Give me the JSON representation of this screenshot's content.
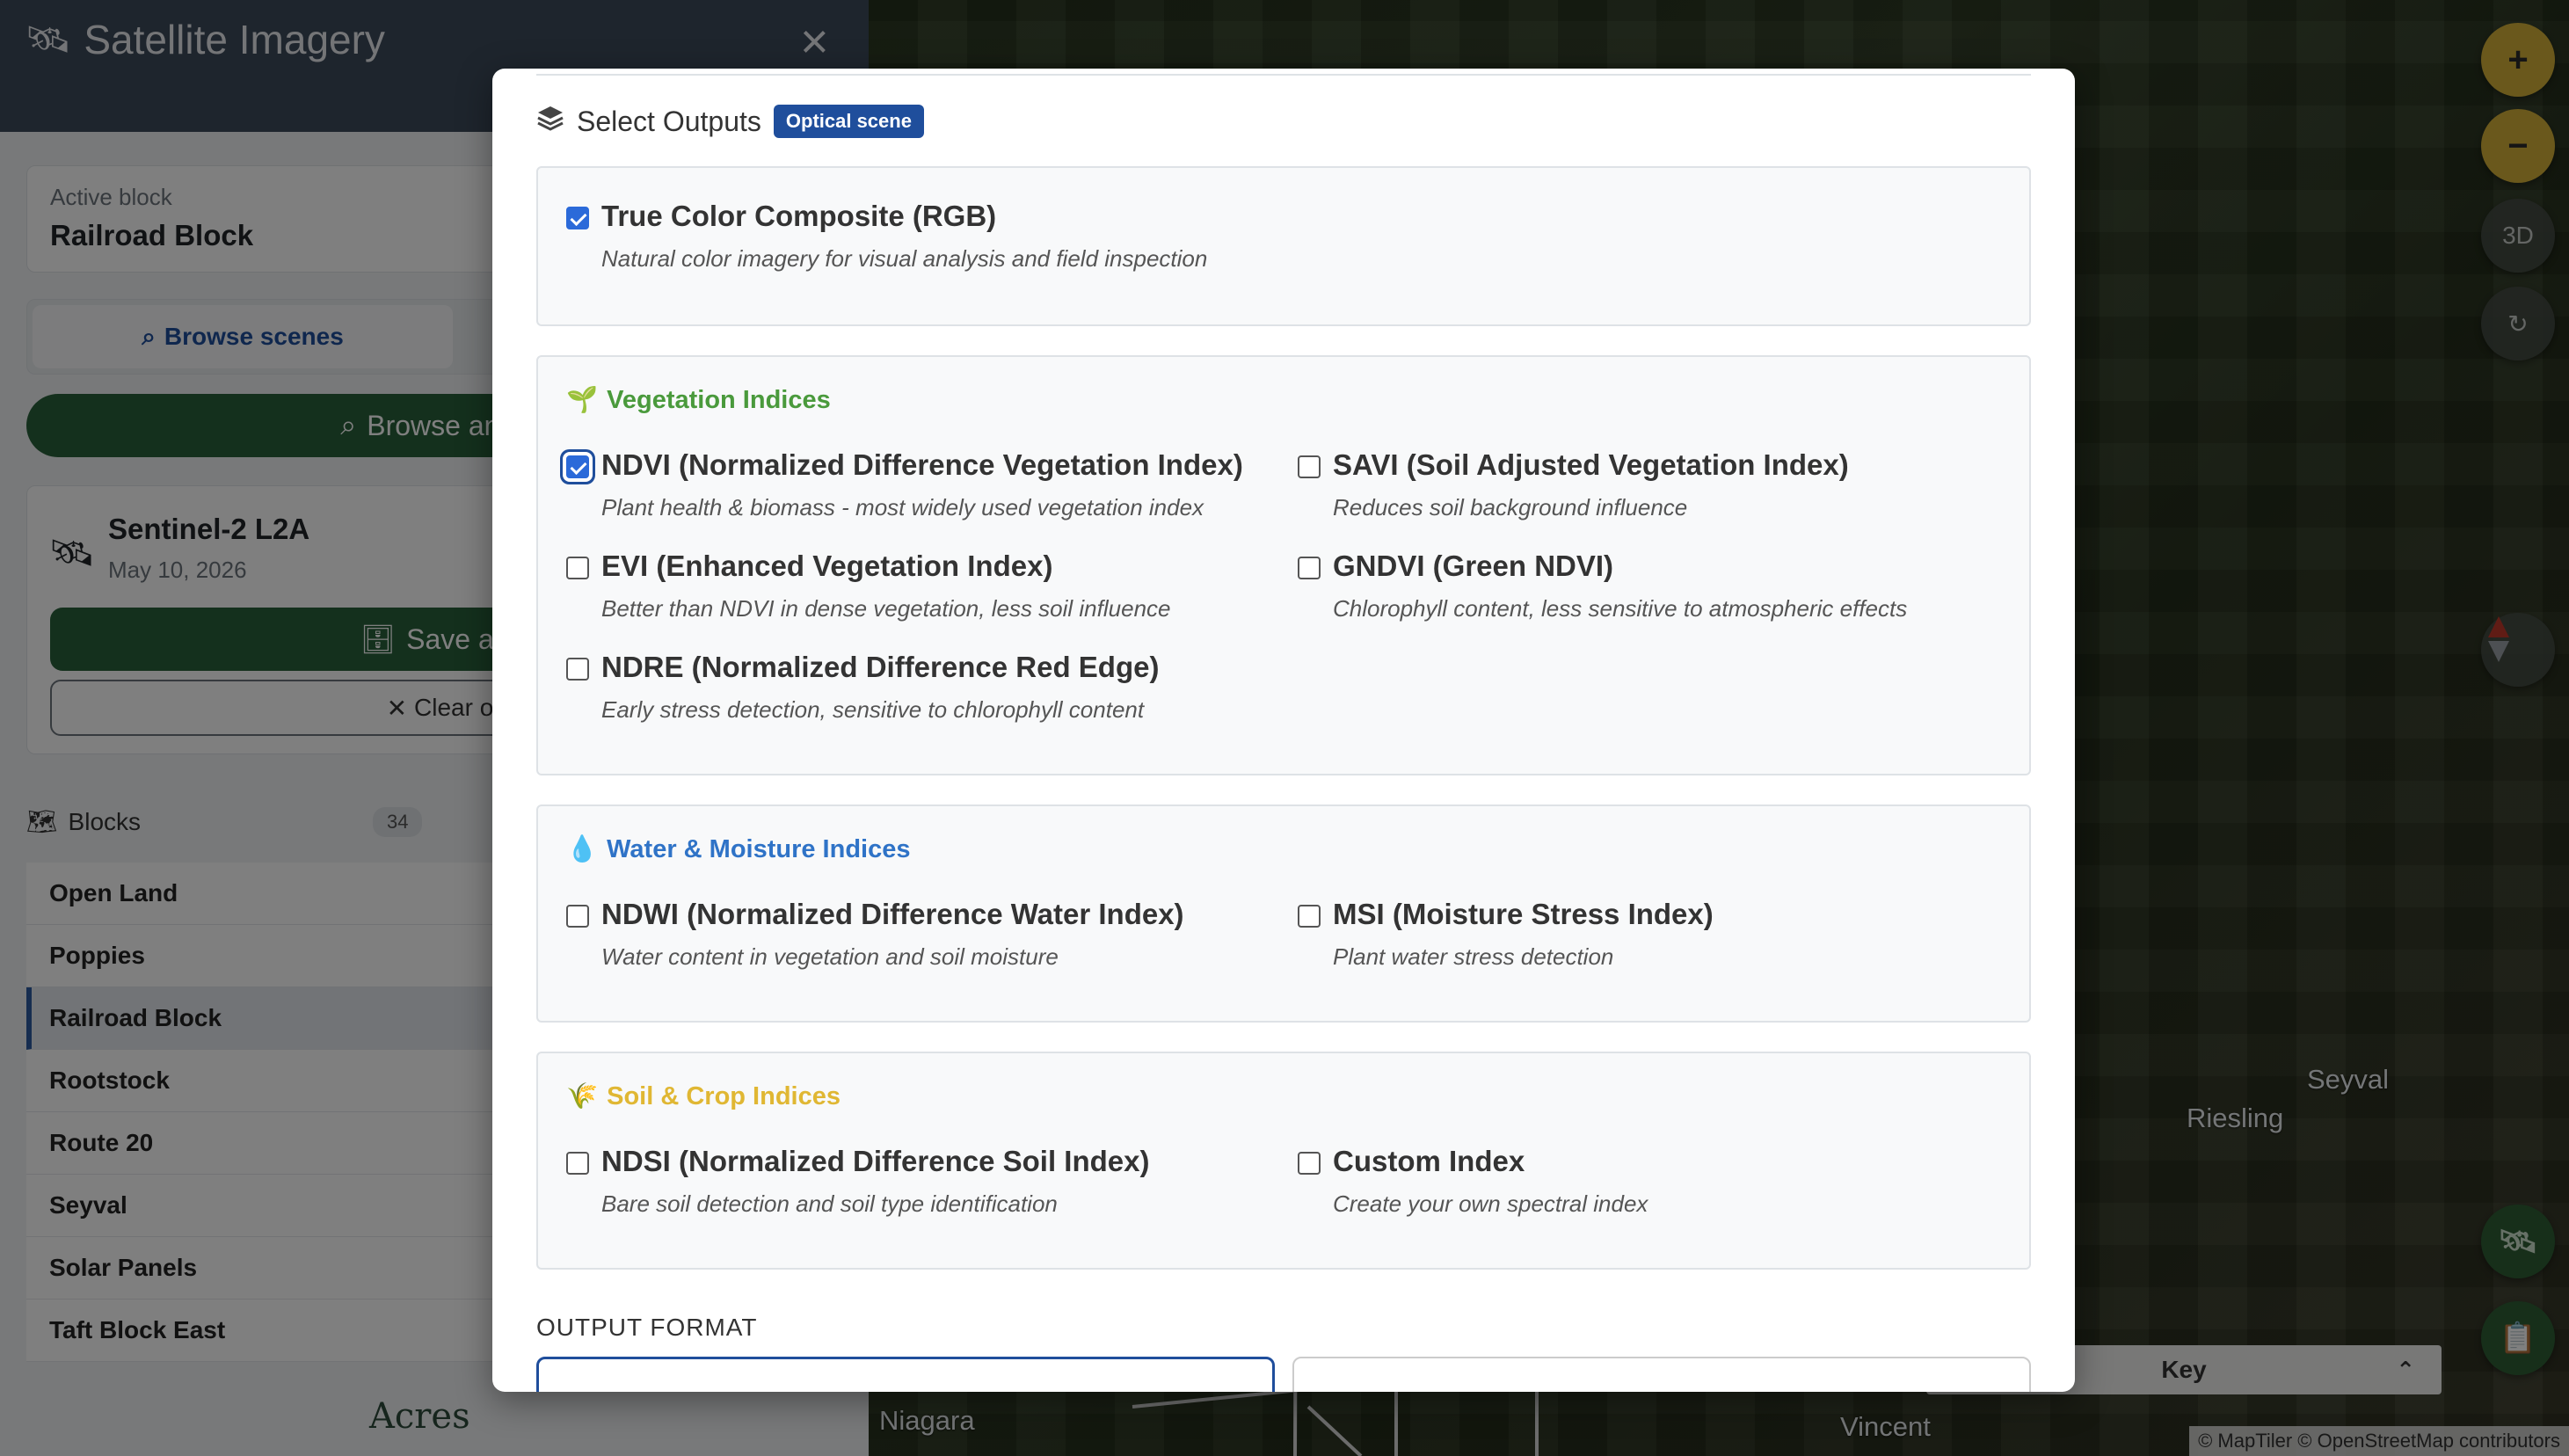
{
  "sidebar": {
    "title": "Satellite Imagery",
    "active_block_label": "Active block",
    "active_block_name": "Railroad Block",
    "tab_browse": "Browse scenes",
    "browse_another": "Browse anothe",
    "scene": {
      "name": "Sentinel-2 L2A",
      "date": "May 10, 2026"
    },
    "save_label": "Save as Dat",
    "clear_label": "Clear overl",
    "blocks_title": "Blocks",
    "blocks_count": "34",
    "blocks": [
      "Open Land",
      "Poppies",
      "Railroad Block",
      "Rootstock",
      "Route 20",
      "Seyval",
      "Solar Panels",
      "Taft Block East"
    ],
    "brand": "Acres"
  },
  "map": {
    "labels": {
      "seyval": "Seyval",
      "riesling": "Riesling",
      "niagara": "Niagara",
      "vincent": "Vincent"
    },
    "zoom_in": "+",
    "zoom_out": "−",
    "view_3d": "3D",
    "key_label": "Key",
    "attribution": "© MapTiler © OpenStreetMap contributors"
  },
  "modal": {
    "section_title": "Select Outputs",
    "badge": "Optical scene",
    "true_color": {
      "label": "True Color Composite (RGB)",
      "desc": "Natural color imagery for visual analysis and field inspection",
      "checked": true
    },
    "vegetation": {
      "title": "Vegetation Indices",
      "color": "#4a9a3c",
      "items": [
        {
          "label": "NDVI (Normalized Difference Vegetation Index)",
          "desc": "Plant health & biomass - most widely used vegetation index",
          "checked": true
        },
        {
          "label": "SAVI (Soil Adjusted Vegetation Index)",
          "desc": "Reduces soil background influence",
          "checked": false
        },
        {
          "label": "EVI (Enhanced Vegetation Index)",
          "desc": "Better than NDVI in dense vegetation, less soil influence",
          "checked": false
        },
        {
          "label": "GNDVI (Green NDVI)",
          "desc": "Chlorophyll content, less sensitive to atmospheric effects",
          "checked": false
        },
        {
          "label": "NDRE (Normalized Difference Red Edge)",
          "desc": "Early stress detection, sensitive to chlorophyll content",
          "checked": false
        }
      ]
    },
    "water": {
      "title": "Water & Moisture Indices",
      "color": "#2f73c7",
      "items": [
        {
          "label": "NDWI (Normalized Difference Water Index)",
          "desc": "Water content in vegetation and soil moisture",
          "checked": false
        },
        {
          "label": "MSI (Moisture Stress Index)",
          "desc": "Plant water stress detection",
          "checked": false
        }
      ]
    },
    "soil": {
      "title": "Soil & Crop Indices",
      "color": "#e0b733",
      "items": [
        {
          "label": "NDSI (Normalized Difference Soil Index)",
          "desc": "Bare soil detection and soil type identification",
          "checked": false
        },
        {
          "label": "Custom Index",
          "desc": "Create your own spectral index",
          "checked": false
        }
      ]
    },
    "output_format_title": "OUTPUT FORMAT"
  }
}
